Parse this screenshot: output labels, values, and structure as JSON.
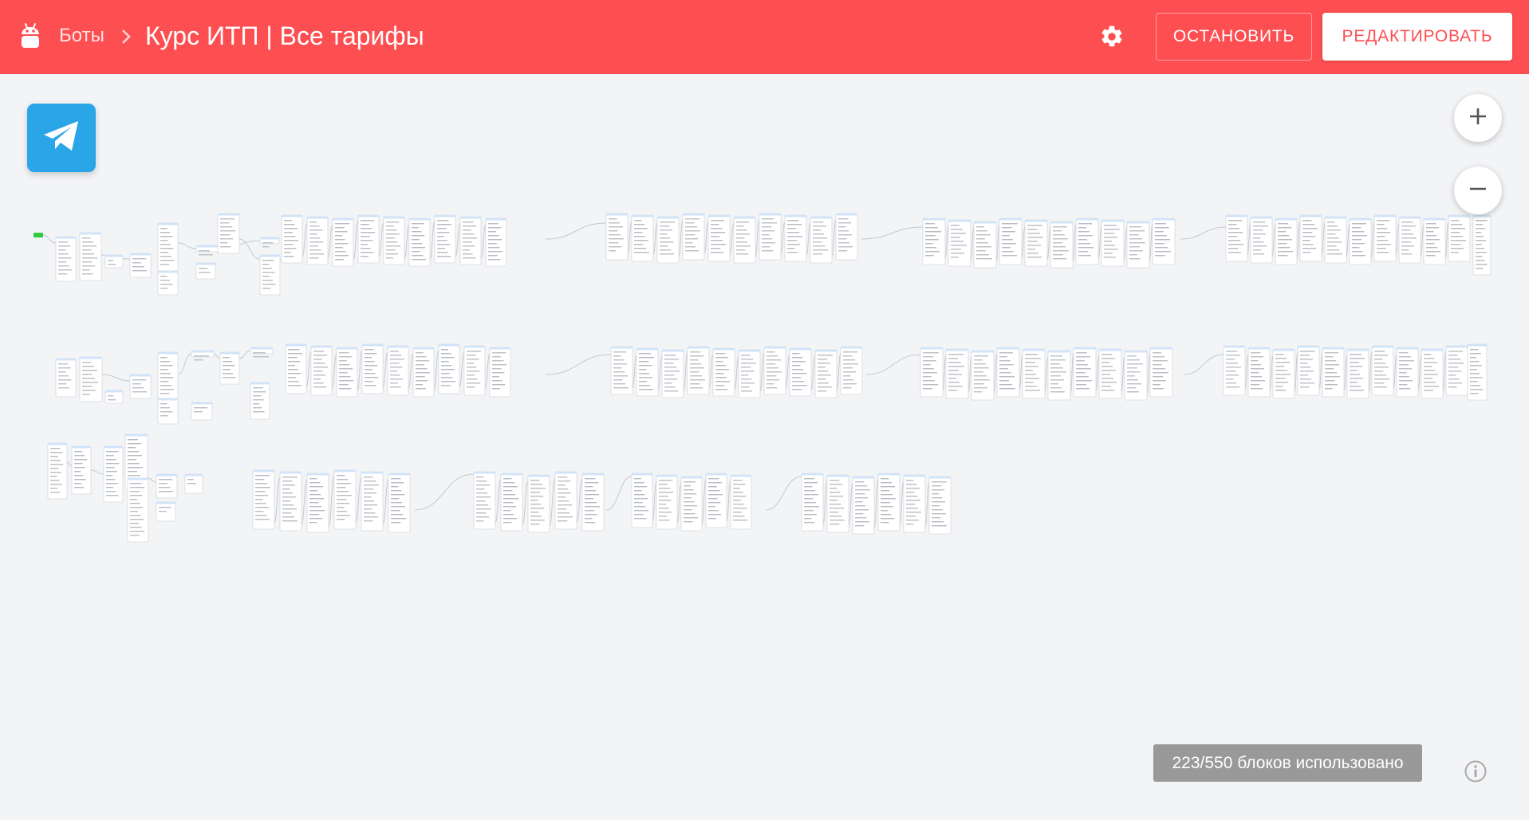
{
  "header": {
    "breadcrumb_root": "Боты",
    "title": "Курс ИТП | Все тарифы",
    "stop_label": "ОСТАНОВИТЬ",
    "edit_label": "РЕДАКТИРОВАТЬ",
    "bot_icon": "android-robot-icon",
    "settings_icon": "gear-icon",
    "separator_icon": "chevron-right-icon"
  },
  "platform": {
    "icon": "telegram-icon"
  },
  "zoom": {
    "in_icon": "plus-icon",
    "out_icon": "minus-icon"
  },
  "status": {
    "blocks_used": "223/550 блоков использовано",
    "info_icon": "info-icon"
  },
  "colors": {
    "header_bg": "#fd4e51",
    "canvas_bg": "#f3f4f6",
    "telegram": "#2aa5e8",
    "counter_bg": "#999999",
    "start_node": "#2ecc40",
    "node_accent": "#cfe3fb"
  }
}
